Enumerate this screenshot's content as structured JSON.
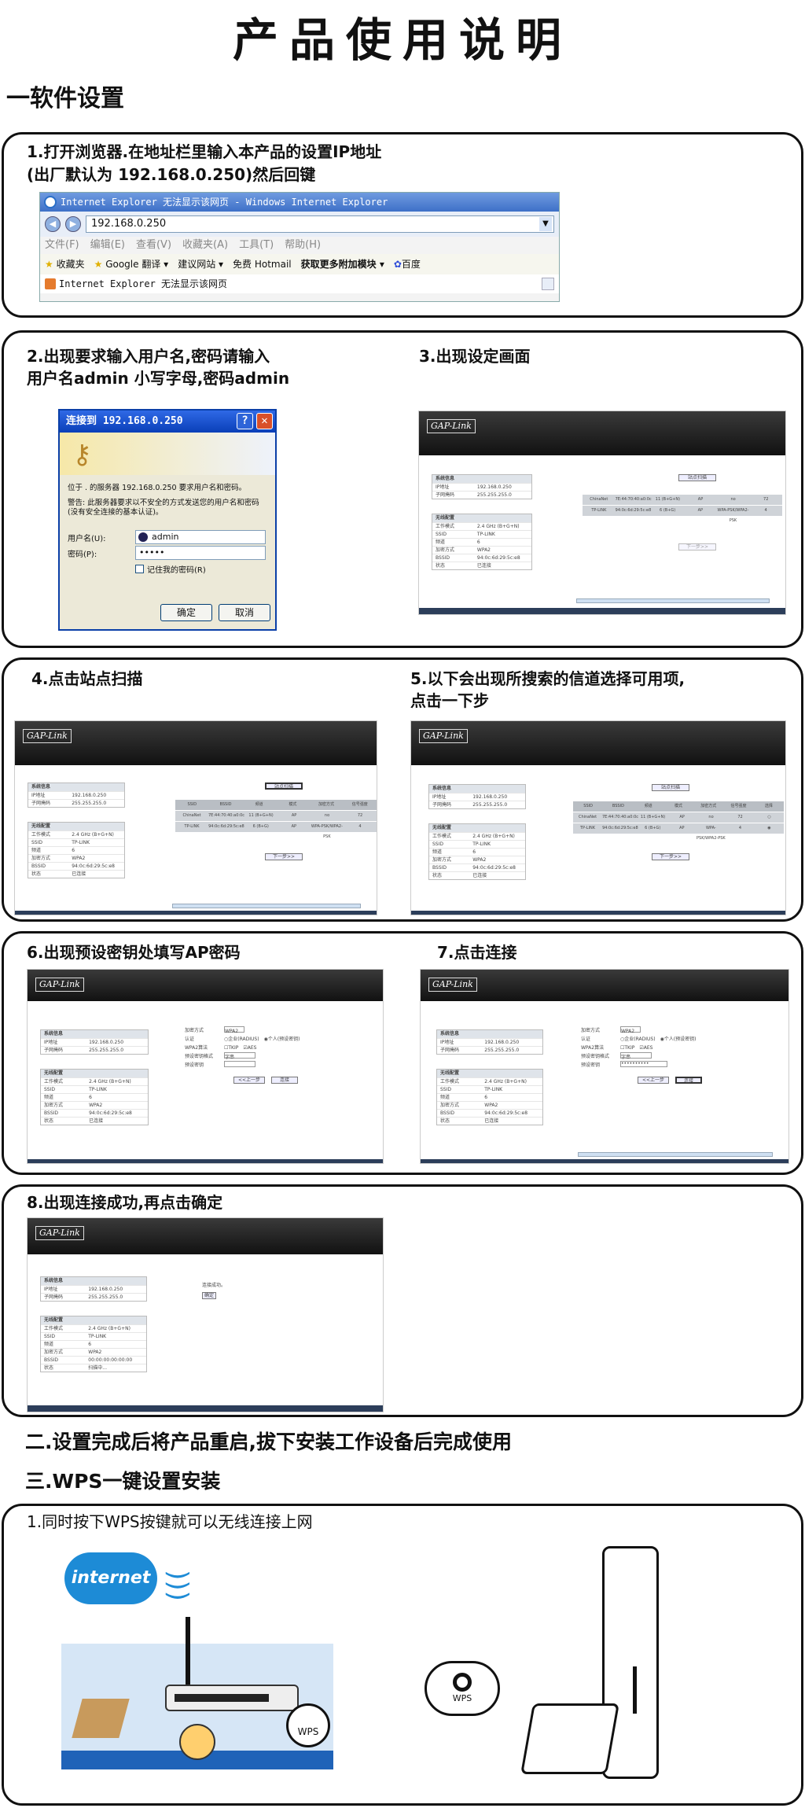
{
  "title": "产品使用说明",
  "sections": {
    "s1": "一软件设置",
    "s2": "二.设置完成后将产品重启,拔下安装工作设备后完成使用",
    "s3": "三.WPS一键设置安装"
  },
  "steps": {
    "step1_line1": "1.打开浏览器.在地址栏里输入本产品的设置IP地址",
    "step1_line2": "(出厂默认为 192.168.0.250)然后回键",
    "step2_line1": "2.出现要求输入用户名,密码请输入",
    "step2_line2": "用户名admin 小写字母,密码admin",
    "step3": "3.出现设定画面",
    "step4": "4.点击站点扫描",
    "step5_line1": "5.以下会出现所搜索的信道选择可用项,",
    "step5_line2": "点击一下步",
    "step6": "6.出现预设密钥处填写AP密码",
    "step7": "7.点击连接",
    "step8": "8.出现连接成功,再点击确定",
    "wps1": "1.同时按下WPS按键就可以无线连接上网"
  },
  "browser": {
    "window_title": "Internet Explorer 无法显示该网页 - Windows Internet Explorer",
    "address": "192.168.0.250",
    "menu": [
      "文件(F)",
      "编辑(E)",
      "查看(V)",
      "收藏夹(A)",
      "工具(T)",
      "帮助(H)"
    ],
    "favorites": [
      "收藏夹",
      "Google 翻译 ▾",
      "建议网站 ▾",
      "免费 Hotmail",
      "获取更多附加模块 ▾",
      "百度"
    ],
    "tab": "Internet Explorer 无法显示该网页"
  },
  "login": {
    "title": "连接到 192.168.0.250",
    "text1": "位于 . 的服务器 192.168.0.250 要求用户名和密码。",
    "text2": "警告: 此服务器要求以不安全的方式发送您的用户名和密码(没有安全连接的基本认证)。",
    "user_label": "用户名(U):",
    "user_value": "admin",
    "pass_label": "密码(P):",
    "pass_value": "•••••",
    "remember": "记住我的密码(R)",
    "ok": "确定",
    "cancel": "取消"
  },
  "router": {
    "logo": "GAP-Link",
    "status_caption": "系统信息",
    "ip_label": "IP地址",
    "ip": "192.168.0.250",
    "mask_label": "子网掩码",
    "mask": "255.255.255.0",
    "set_link": "(设置)",
    "wlan_caption": "无线配置",
    "mode_label": "工作模式",
    "mode": "2.4 GHz (B+G+N)",
    "ssid_label": "SSID",
    "ssid": "TP-LINK",
    "channel_label": "频道",
    "channel": "6",
    "enc_label": "加密方式",
    "enc": "WPA2",
    "bssid_label": "BSSID",
    "bssid": "94:0c:6d:29:5c:e8",
    "state_label": "状态",
    "state": "已连接",
    "state_connecting": "扫描中...",
    "bssid_zero": "00:00:00:00:00:00",
    "scan_btn": "站点扫描",
    "next_btn": "下一步>>",
    "prev_btn": "<<上一步",
    "connect_btn": "连接",
    "success": "连接成功。",
    "ok_btn": "确定",
    "grid_head": [
      "SSID",
      "BSSID",
      "频道",
      "模式",
      "加密方式",
      "信号强度",
      "选择"
    ],
    "grid_row1": [
      "ChinaNet",
      "7E:44:70:40:a0:0c",
      "11 (B+G+N)",
      "AP",
      "no",
      "72",
      ""
    ],
    "grid_row2": [
      "TP-LINK",
      "94:0c:6d:29:5c:e8",
      "6 (B+G)",
      "AP",
      "WPA-PSK/WPA2-PSK",
      "4",
      ""
    ],
    "auth_label": "认证",
    "auth_value": "WPA2",
    "auth_opt1": "企业(RADIUS)",
    "auth_opt2": "个人(预设密钥)",
    "cipher_label": "WPA2算法",
    "cipher_tkip": "TKIP",
    "cipher_aes": "AES",
    "keyformat_label": "预设密钥格式",
    "keyformat_value": "字串",
    "key_label": "预设密钥",
    "key_value": "••••••••••"
  },
  "wps": {
    "internet": "internet",
    "wps_label": "WPS"
  }
}
